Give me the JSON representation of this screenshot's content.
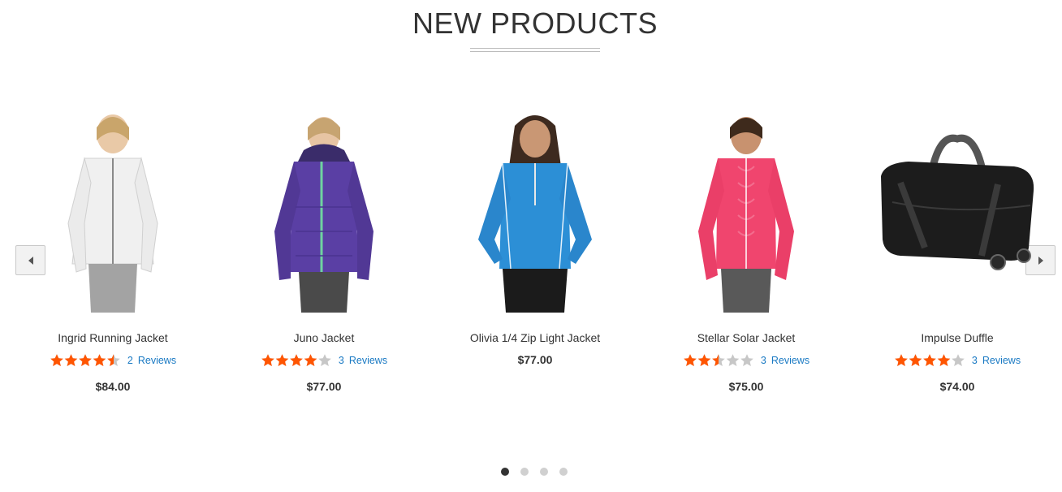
{
  "section": {
    "title": "NEW PRODUCTS"
  },
  "carousel": {
    "prev_icon": "triangle-left-icon",
    "next_icon": "triangle-right-icon",
    "dots_count": 4,
    "active_dot": 1
  },
  "colors": {
    "star": "#ff5501",
    "star_empty": "#c7c7c7",
    "link": "#1979c3"
  },
  "products": [
    {
      "name": "Ingrid Running Jacket",
      "rating": 4.5,
      "review_count": "2",
      "review_word": "Reviews",
      "price": "$84.00",
      "image": "white-jacket-photo"
    },
    {
      "name": "Juno Jacket",
      "rating": 4.0,
      "review_count": "3",
      "review_word": "Reviews",
      "price": "$77.00",
      "image": "purple-jacket-photo"
    },
    {
      "name": "Olivia 1/4 Zip Light Jacket",
      "rating": null,
      "review_count": null,
      "review_word": null,
      "price": "$77.00",
      "image": "blue-jacket-photo"
    },
    {
      "name": "Stellar Solar Jacket",
      "rating": 2.5,
      "review_count": "3",
      "review_word": "Reviews",
      "price": "$75.00",
      "image": "pink-jacket-photo"
    },
    {
      "name": "Impulse Duffle",
      "rating": 4.0,
      "review_count": "3",
      "review_word": "Reviews",
      "price": "$74.00",
      "image": "black-duffle-photo"
    }
  ]
}
